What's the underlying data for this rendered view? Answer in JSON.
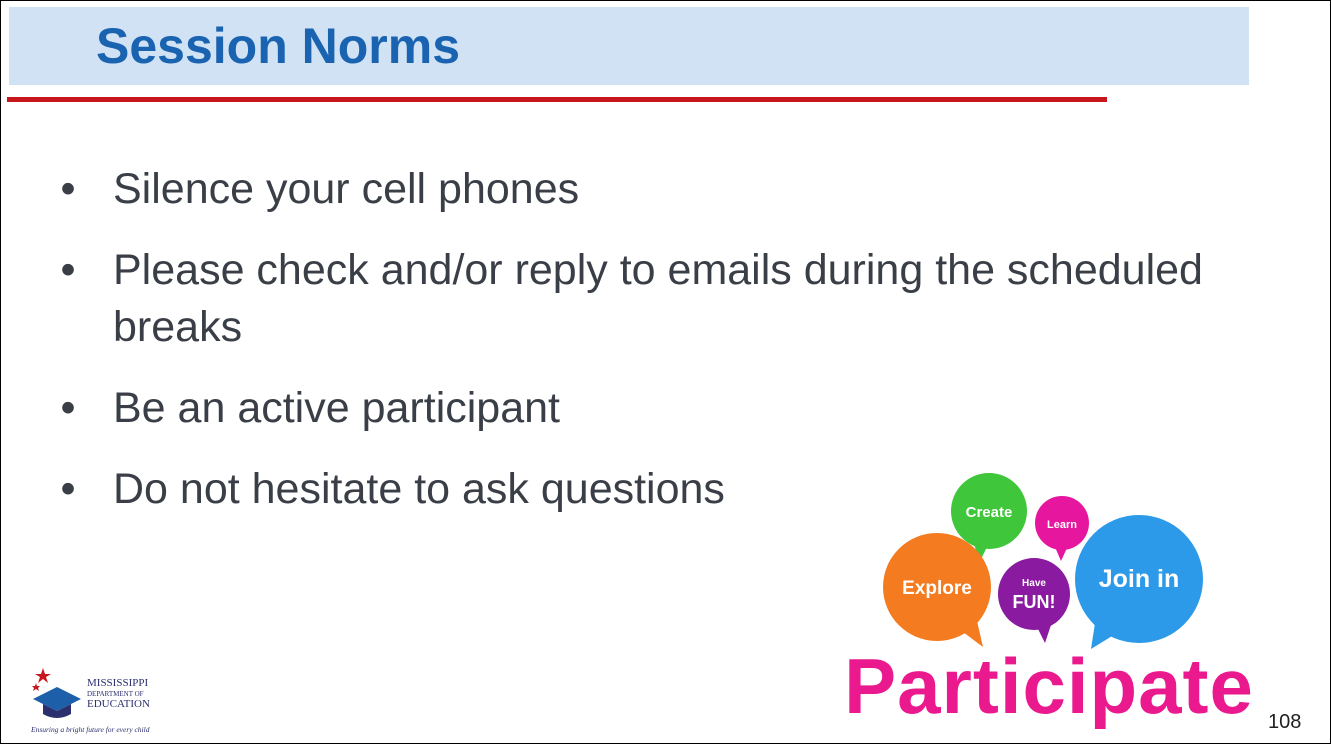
{
  "slide": {
    "title": "Session Norms",
    "page_number": "108"
  },
  "bullets": [
    {
      "text": "Silence your cell phones"
    },
    {
      "text": "Please check and/or reply to emails during the scheduled breaks"
    },
    {
      "text": "Be an active participant"
    },
    {
      "text": "Do not hesitate to ask questions"
    }
  ],
  "participate_image": {
    "word": "Participate",
    "bubbles": [
      "Create",
      "Learn",
      "Explore",
      "Have",
      "FUN!",
      "Join in"
    ]
  },
  "logo": {
    "line1": "MISSISSIPPI",
    "line2": "DEPARTMENT OF",
    "line3": "EDUCATION",
    "tagline": "Ensuring a bright future for every child"
  },
  "colors": {
    "title": "#1a63b0",
    "title_band": "#d0e2f3",
    "rule": "#c8161d",
    "body_text": "#3a3f47",
    "green": "#3fc63a",
    "magenta": "#e6169e",
    "orange": "#f47b20",
    "purple": "#8a1aa0",
    "blue": "#2c9ae8",
    "participate": "#ea1a8e"
  }
}
